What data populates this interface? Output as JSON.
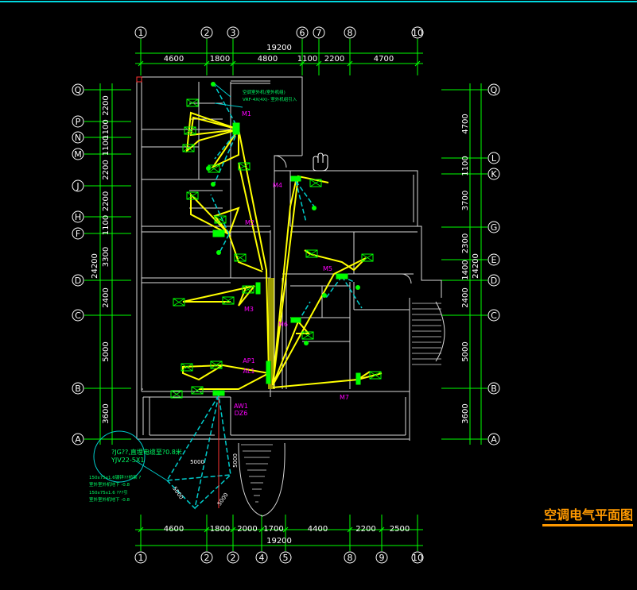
{
  "drawing_title": "空调电气平面图",
  "colors": {
    "background": "#000000",
    "top_rule": "#00d8e0",
    "wall": "#d8d8d8",
    "grid": "#00ff00",
    "wire_yellow": "#ffff00",
    "wire_cyan": "#00cccc",
    "equipment": "#00ff00",
    "label_magenta": "#ff00ff",
    "note_green": "#00ff66",
    "title_orange": "#ff9900"
  },
  "top_axes": [
    "1",
    "2",
    "3",
    "6",
    "7",
    "8",
    "10"
  ],
  "top_total": "19200",
  "top_dims": [
    "4600",
    "1800",
    "4800",
    "1100",
    "2200",
    "4700"
  ],
  "bottom_axes": [
    "1",
    "2",
    "2",
    "4",
    "5",
    "8",
    "9",
    "10"
  ],
  "bottom_total": "19200",
  "bottom_dims": [
    "4600",
    "1800",
    "2000",
    "1700",
    "4400",
    "2200",
    "2500"
  ],
  "left_axes": [
    "Q",
    "P",
    "N",
    "M",
    "J",
    "H",
    "F",
    "D",
    "C",
    "B",
    "A"
  ],
  "left_dims": [
    "2200",
    "1100",
    "1100",
    "2200",
    "2200",
    "1100",
    "3300",
    "2400",
    "5000",
    "3600"
  ],
  "left_total": "24200",
  "right_axes": [
    "Q",
    "L",
    "K",
    "G",
    "E",
    "D",
    "C",
    "B",
    "A"
  ],
  "right_dims": [
    "4700",
    "1100",
    "3700",
    "2300",
    "1400",
    "2400",
    "5000",
    "3600"
  ],
  "right_total": "24200",
  "panel_labels": [
    "M1",
    "M2",
    "M3",
    "M4",
    "M5",
    "M6",
    "M7"
  ],
  "box_labels": [
    "AP1",
    "AL1",
    "AW1",
    "DZ6"
  ],
  "site_dims": [
    "5000",
    "5000",
    "5000",
    "5000"
  ],
  "notes": [
    "空调室外机(室外机组)",
    "VRF-4X(4X)- 室外机组引入",
    "?JG??,直埋电缆至?0.8米",
    "YJV22-5X1",
    "150x75x1.6镀锌??桥架 ?",
    "室外室外机地下  -0.8",
    "150x75x1.6 ???引  ",
    "室外室外机地下 -0.8"
  ]
}
